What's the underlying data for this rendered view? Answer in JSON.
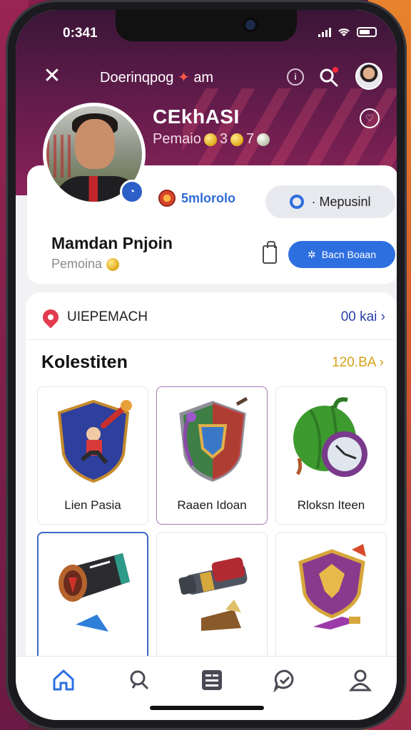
{
  "status": {
    "time": "0:341"
  },
  "header": {
    "title": "Doerinqpog",
    "title_suffix": "am"
  },
  "profile": {
    "display_name": "CEkhASI",
    "sub_label": "Pemaio",
    "sub_values": "3",
    "sub_values2": "7"
  },
  "card": {
    "stat_label": "5mlorolo",
    "secondary_button": "· Mepusinl",
    "name": "Mamdan Pnjoin",
    "role": "Pemoina",
    "primary_button": "Bacn Boaan"
  },
  "location": {
    "label": "UIEPEMACH",
    "link": "00 kai ›"
  },
  "collection": {
    "title": "Kolestiten",
    "link": "120.BA ›",
    "items": [
      {
        "label": "Lien Pasia"
      },
      {
        "label": "Raaen Idoan"
      },
      {
        "label": "Rloksn Iteen"
      },
      {
        "label": ""
      },
      {
        "label": ""
      },
      {
        "label": ""
      }
    ]
  },
  "nav": {
    "items": [
      "home-icon",
      "search-icon",
      "list-icon",
      "chat-icon",
      "profile-icon"
    ]
  },
  "colors": {
    "accent": "#2e6fe0",
    "brand": "#8a2258",
    "link_gold": "#d5a11b"
  }
}
